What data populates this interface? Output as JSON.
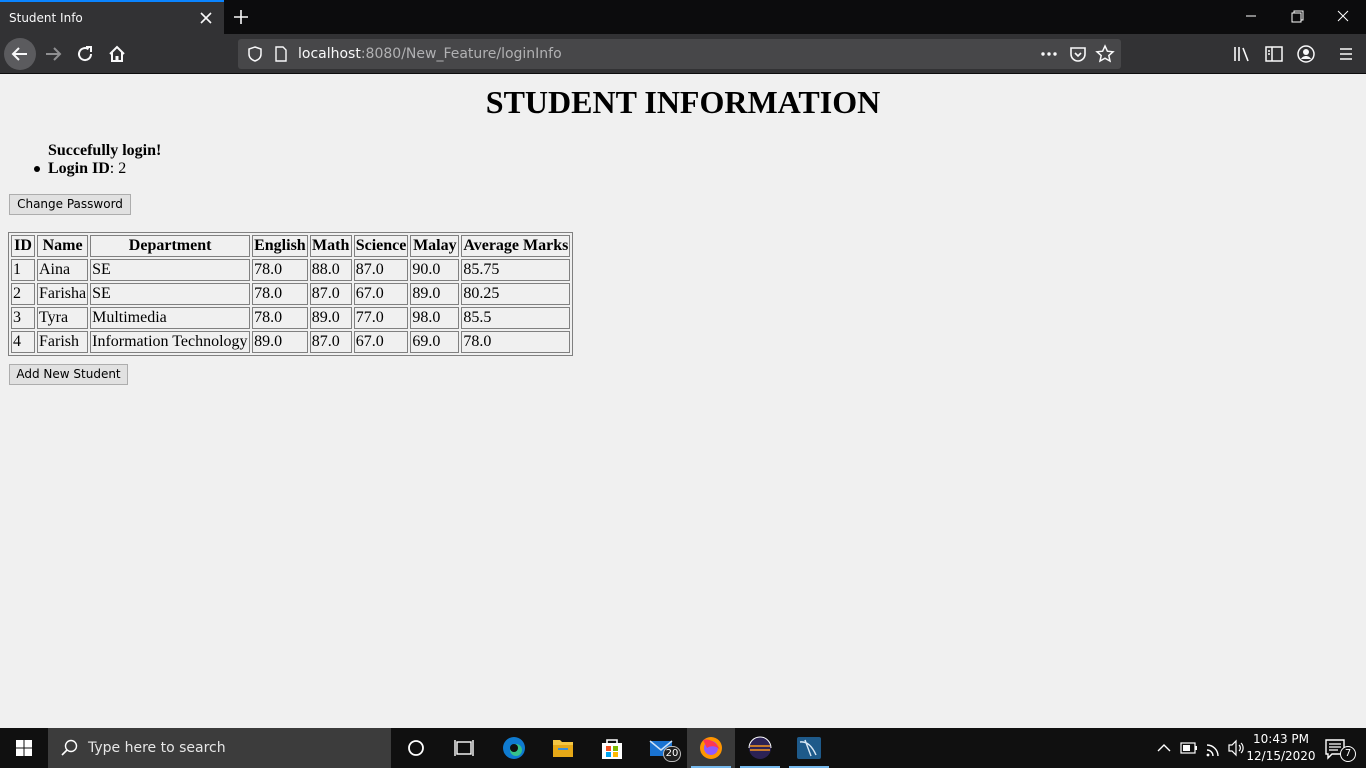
{
  "browser": {
    "tab_title": "Student Info",
    "url_host": "localhost",
    "url_rest": ":8080/New_Feature/loginInfo"
  },
  "page": {
    "title": "STUDENT INFORMATION",
    "success_message": "Succefully login!",
    "login_label": "Login ID",
    "login_value": ": 2",
    "change_password_label": "Change Password",
    "add_student_label": "Add New Student"
  },
  "table": {
    "headers": [
      "ID",
      "Name",
      "Department",
      "English",
      "Math",
      "Science",
      "Malay",
      "Average Marks"
    ],
    "rows": [
      [
        "1",
        "Aina",
        "SE",
        "78.0",
        "88.0",
        "87.0",
        "90.0",
        "85.75"
      ],
      [
        "2",
        "Farisha",
        "SE",
        "78.0",
        "87.0",
        "67.0",
        "89.0",
        "80.25"
      ],
      [
        "3",
        "Tyra",
        "Multimedia",
        "78.0",
        "89.0",
        "77.0",
        "98.0",
        "85.5"
      ],
      [
        "4",
        "Farish",
        "Information Technology",
        "89.0",
        "87.0",
        "67.0",
        "69.0",
        "78.0"
      ]
    ]
  },
  "taskbar": {
    "search_placeholder": "Type here to search",
    "mail_badge": "20",
    "time": "10:43 PM",
    "date": "12/15/2020",
    "notification_count": "7"
  },
  "colors": {
    "accent": "#0a84ff",
    "chrome_dark": "#0c0c0d",
    "toolbar": "#323234",
    "page_bg": "#f0f0f0",
    "taskbar": "#101010"
  }
}
